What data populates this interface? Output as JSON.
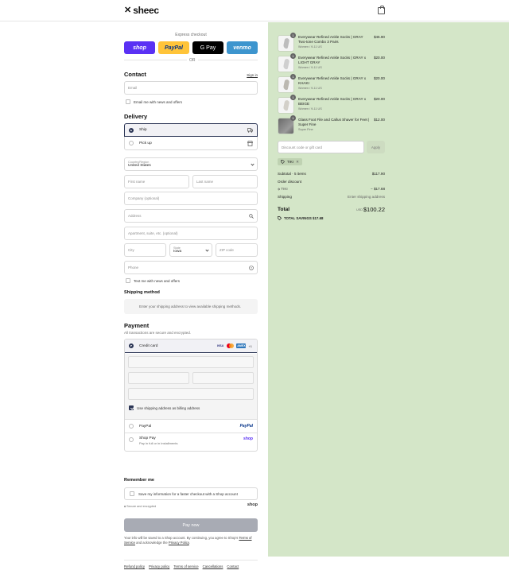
{
  "brand": {
    "logo_mark": "✕",
    "name": "sheec"
  },
  "express": {
    "title": "Express checkout",
    "buttons": {
      "shop": "shop",
      "paypal": "PayPal",
      "gpay": "G Pay",
      "venmo": "venmo"
    },
    "or_label": "OR"
  },
  "contact": {
    "title": "Contact",
    "sign_in": "Sign in",
    "email_placeholder": "Email",
    "newsletter_label": "Email me with news and offers"
  },
  "delivery": {
    "title": "Delivery",
    "options": [
      {
        "label": "Ship",
        "selected": true
      },
      {
        "label": "Pick up",
        "selected": false
      }
    ],
    "country_label": "Country/Region",
    "country_value": "United States",
    "first_name": "First name",
    "last_name": "Last name",
    "company": "Company (optional)",
    "address": "Address",
    "apartment": "Apartment, suite, etc. (optional)",
    "city": "City",
    "state_label": "State",
    "state_value": "Iowa",
    "zip": "ZIP code",
    "phone": "Phone",
    "sms_label": "Text me with news and offers"
  },
  "shipping_method": {
    "title": "Shipping method",
    "placeholder": "Enter your shipping address to view available shipping methods."
  },
  "payment": {
    "title": "Payment",
    "subtitle": "All transactions are secure and encrypted.",
    "credit_card": "Credit card",
    "card_logos": {
      "visa": "VISA",
      "amex": "AMEX",
      "more": "+1"
    },
    "billing_same": "Use shipping address as billing address",
    "paypal_label": "PayPal",
    "paypal_logo": "PayPal",
    "shoppay_label": "Shop Pay",
    "shoppay_sub": "Pay in full or in installments",
    "shoppay_logo": "shop"
  },
  "remember": {
    "title": "Remember me",
    "label": "Save my information for a faster checkout with a Shop account",
    "secure": "Secure and encrypted",
    "shop_mark": "shop"
  },
  "pay_now": "Pay now",
  "legal": {
    "text_1": "Your info will be saved to a Shop account. By continuing, you agree to Shop's",
    "terms": "Terms of Service",
    "text_2": "and acknowledge the",
    "privacy": "Privacy Policy",
    "text_3": "."
  },
  "footer_links": [
    "Refund policy",
    "Privacy policy",
    "Terms of service",
    "Cancellations",
    "Contact"
  ],
  "cart": {
    "items": [
      {
        "title": "Everywear Refined Ankle Socks | GRAY Two-tone Combo 3 Pairs",
        "variant": "Women / 9-11 US",
        "price": "$45.90",
        "qty": "1",
        "image": "sock-gray"
      },
      {
        "title": "Everywear Refined Ankle Socks | GRAY x LIGHT GRAY",
        "variant": "Women / 9-11 US",
        "price": "$20.00",
        "qty": "1",
        "image": "sock-light"
      },
      {
        "title": "Everywear Refined Ankle Socks | GRAY x KHAKI",
        "variant": "Women / 9-11 US",
        "price": "$20.00",
        "qty": "1",
        "image": "sock-khaki"
      },
      {
        "title": "Everywear Refined Ankle Socks | GRAY x BEIGE",
        "variant": "Women / 9-11 US",
        "price": "$20.00",
        "qty": "1",
        "image": "sock-beige"
      },
      {
        "title": "Glass Foot File and Callus Shaver for Feet | Super Fine",
        "variant": "Super Fine",
        "price": "$12.00",
        "qty": "1",
        "image": "glass-file"
      }
    ],
    "discount_placeholder": "Discount code or gift card",
    "apply": "Apply",
    "applied_code": "TIKI",
    "subtotal_label": "Subtotal · 5 items",
    "subtotal_value": "$117.90",
    "order_discount_label": "Order discount",
    "order_discount_code": "TIKI",
    "order_discount_value": "− $17.68",
    "shipping_label": "Shipping",
    "shipping_value": "Enter shipping address",
    "total_label": "Total",
    "currency": "USD",
    "total_value": "$100.22",
    "savings": "TOTAL SAVINGS $17.68"
  },
  "colors": {
    "summary_bg": "#d4e6c8",
    "shop_purple": "#5a31f4",
    "paypal_yellow": "#ffc439",
    "venmo_blue": "#3d95ce",
    "pay_button_disabled": "#a8abb4",
    "selected_border": "#2b3555"
  },
  "icons": {
    "cart": "bag-icon",
    "ship": "truck-icon",
    "pickup": "store-icon",
    "address_search": "search-icon",
    "phone_help": "help-circle-icon",
    "tag": "tag-icon",
    "lock": "lock-icon"
  }
}
